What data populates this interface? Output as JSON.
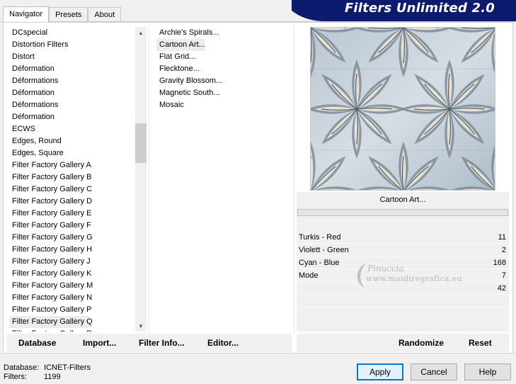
{
  "app": {
    "title": "Filters Unlimited 2.0"
  },
  "tabs": [
    {
      "label": "Navigator"
    },
    {
      "label": "Presets"
    },
    {
      "label": "About"
    }
  ],
  "categories": [
    "DCspecial",
    "Distortion Filters",
    "Distort",
    "Déformation",
    "Déformations",
    "Déformation",
    "Déformations",
    "Déformation",
    "ECWS",
    "Edges, Round",
    "Edges, Square",
    "Filter Factory Gallery A",
    "Filter Factory Gallery B",
    "Filter Factory Gallery C",
    "Filter Factory Gallery D",
    "Filter Factory Gallery E",
    "Filter Factory Gallery F",
    "Filter Factory Gallery G",
    "Filter Factory Gallery H",
    "Filter Factory Gallery J",
    "Filter Factory Gallery K",
    "Filter Factory Gallery M",
    "Filter Factory Gallery N",
    "Filter Factory Gallery P",
    "Filter Factory Gallery Q",
    "Filter Factory Gallery R"
  ],
  "selected_category": "Filter Factory Gallery Q",
  "filters": [
    "Archie's Spirals...",
    "Cartoon Art...",
    "Flat Grid...",
    "Flecktone...",
    "Gravity Blossom...",
    "Magnetic South...",
    "Mosaic"
  ],
  "selected_filter": "Cartoon Art...",
  "preview": {
    "filter_name": "Cartoon Art..."
  },
  "params": [
    {
      "label": "Turkis - Red",
      "value": "11"
    },
    {
      "label": "Violett - Green",
      "value": "2"
    },
    {
      "label": "Cyan  - Blue",
      "value": "168"
    },
    {
      "label": "Mode",
      "value": "7"
    },
    {
      "label": "",
      "value": "42"
    }
  ],
  "watermark": {
    "name": "Pinuccia",
    "url": "www.maidiregrafica.eu"
  },
  "toolbar": {
    "database_label": "Database",
    "import_label": "Import...",
    "filter_info_label": "Filter Info...",
    "editor_label": "Editor...",
    "randomize_label": "Randomize",
    "reset_label": "Reset"
  },
  "status": {
    "database_label": "Database:",
    "database_value": "ICNET-Filters",
    "filters_label": "Filters:",
    "filters_value": "1199"
  },
  "buttons": {
    "apply": "Apply",
    "cancel": "Cancel",
    "help": "Help"
  },
  "colors": {
    "banner": "#0d1b6e",
    "default_button_border": "#0078d7"
  }
}
